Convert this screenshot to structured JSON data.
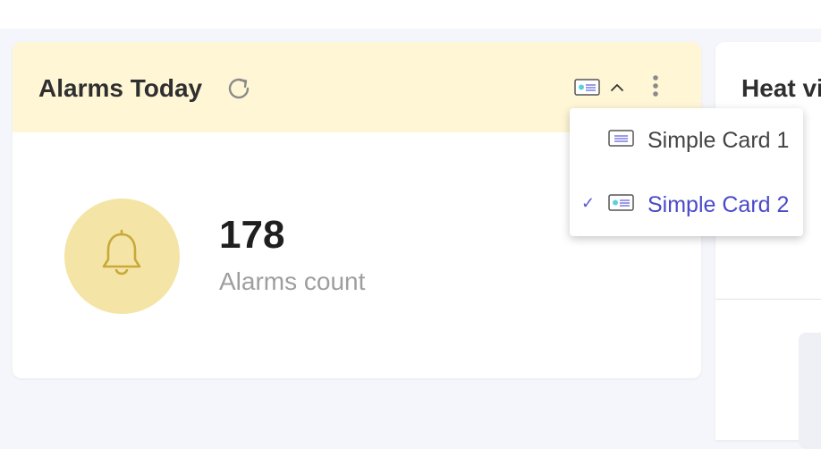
{
  "widget": {
    "title": "Alarms Today",
    "count": "178",
    "count_label": "Alarms count",
    "header_bg": "#fff6d6",
    "icon_bg": "#f4e4a6",
    "icons": [
      "refresh-icon",
      "card-style-icon",
      "chevron-up-icon",
      "more-vertical-icon",
      "bell-icon"
    ]
  },
  "next_widget": {
    "title": "Heat vi"
  },
  "dropdown": {
    "items": [
      {
        "label": "Simple Card 1",
        "selected": false
      },
      {
        "label": "Simple Card 2",
        "selected": true
      }
    ],
    "selected_color": "#4a4ac9",
    "check_mark": "✓"
  }
}
